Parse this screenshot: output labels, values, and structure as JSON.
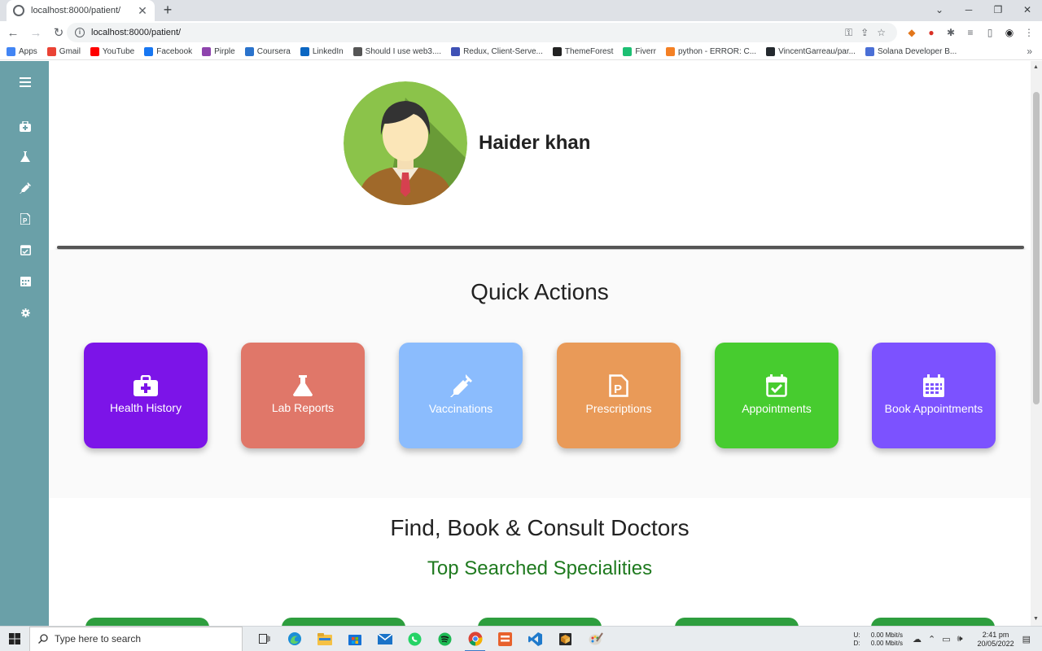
{
  "browser": {
    "tab_title": "localhost:8000/patient/",
    "tab_close": "✕",
    "new_tab": "+",
    "url": "localhost:8000/patient/",
    "bookmarks": [
      {
        "label": "Apps",
        "color": "#4285f4"
      },
      {
        "label": "Gmail",
        "color": "#ea4335"
      },
      {
        "label": "YouTube",
        "color": "#ff0000"
      },
      {
        "label": "Facebook",
        "color": "#1877f2"
      },
      {
        "label": "Pirple",
        "color": "#8e44ad"
      },
      {
        "label": "Coursera",
        "color": "#2a73cc"
      },
      {
        "label": "LinkedIn",
        "color": "#0a66c2"
      },
      {
        "label": "Should I use web3....",
        "color": "#555555"
      },
      {
        "label": "Redux, Client-Serve...",
        "color": "#3f51b5"
      },
      {
        "label": "ThemeForest",
        "color": "#222222"
      },
      {
        "label": "Fiverr",
        "color": "#1dbf73"
      },
      {
        "label": "python - ERROR: C...",
        "color": "#f48024"
      },
      {
        "label": "VincentGarreau/par...",
        "color": "#24292e"
      },
      {
        "label": "Solana Developer B...",
        "color": "#4a6fd6"
      }
    ]
  },
  "profile": {
    "name": "Haider khan"
  },
  "quick_actions": {
    "title": "Quick Actions",
    "cards": [
      {
        "label": "Health History",
        "color": "#7c14e8",
        "icon": "medkit-icon"
      },
      {
        "label": "Lab Reports",
        "color": "#e07769",
        "icon": "flask-icon"
      },
      {
        "label": "Vaccinations",
        "color": "#8bbcfd",
        "icon": "syringe-icon"
      },
      {
        "label": "Prescriptions",
        "color": "#e99a58",
        "icon": "prescription-icon"
      },
      {
        "label": "Appointments",
        "color": "#47cc2f",
        "icon": "calendar-check-icon"
      },
      {
        "label": "Book Appointments",
        "color": "#7c52ff",
        "icon": "calendar-icon"
      }
    ]
  },
  "doctors": {
    "title": "Find, Book & Consult Doctors",
    "subtitle": "Top Searched Specialities"
  },
  "sidebar": {
    "color": "#6aa0a8",
    "items": [
      "menu-icon",
      "medkit-icon",
      "flask-icon",
      "syringe-icon",
      "prescription-icon",
      "calendar-check-icon",
      "calendar-icon",
      "gear-icon"
    ]
  },
  "taskbar": {
    "search_placeholder": "Type here to search",
    "net_up": "U:",
    "net_down": "D:",
    "net_up_value": "0.00 Mbit/s",
    "net_down_value": "0.00 Mbit/s",
    "time": "2:41 pm",
    "date": "20/05/2022"
  }
}
